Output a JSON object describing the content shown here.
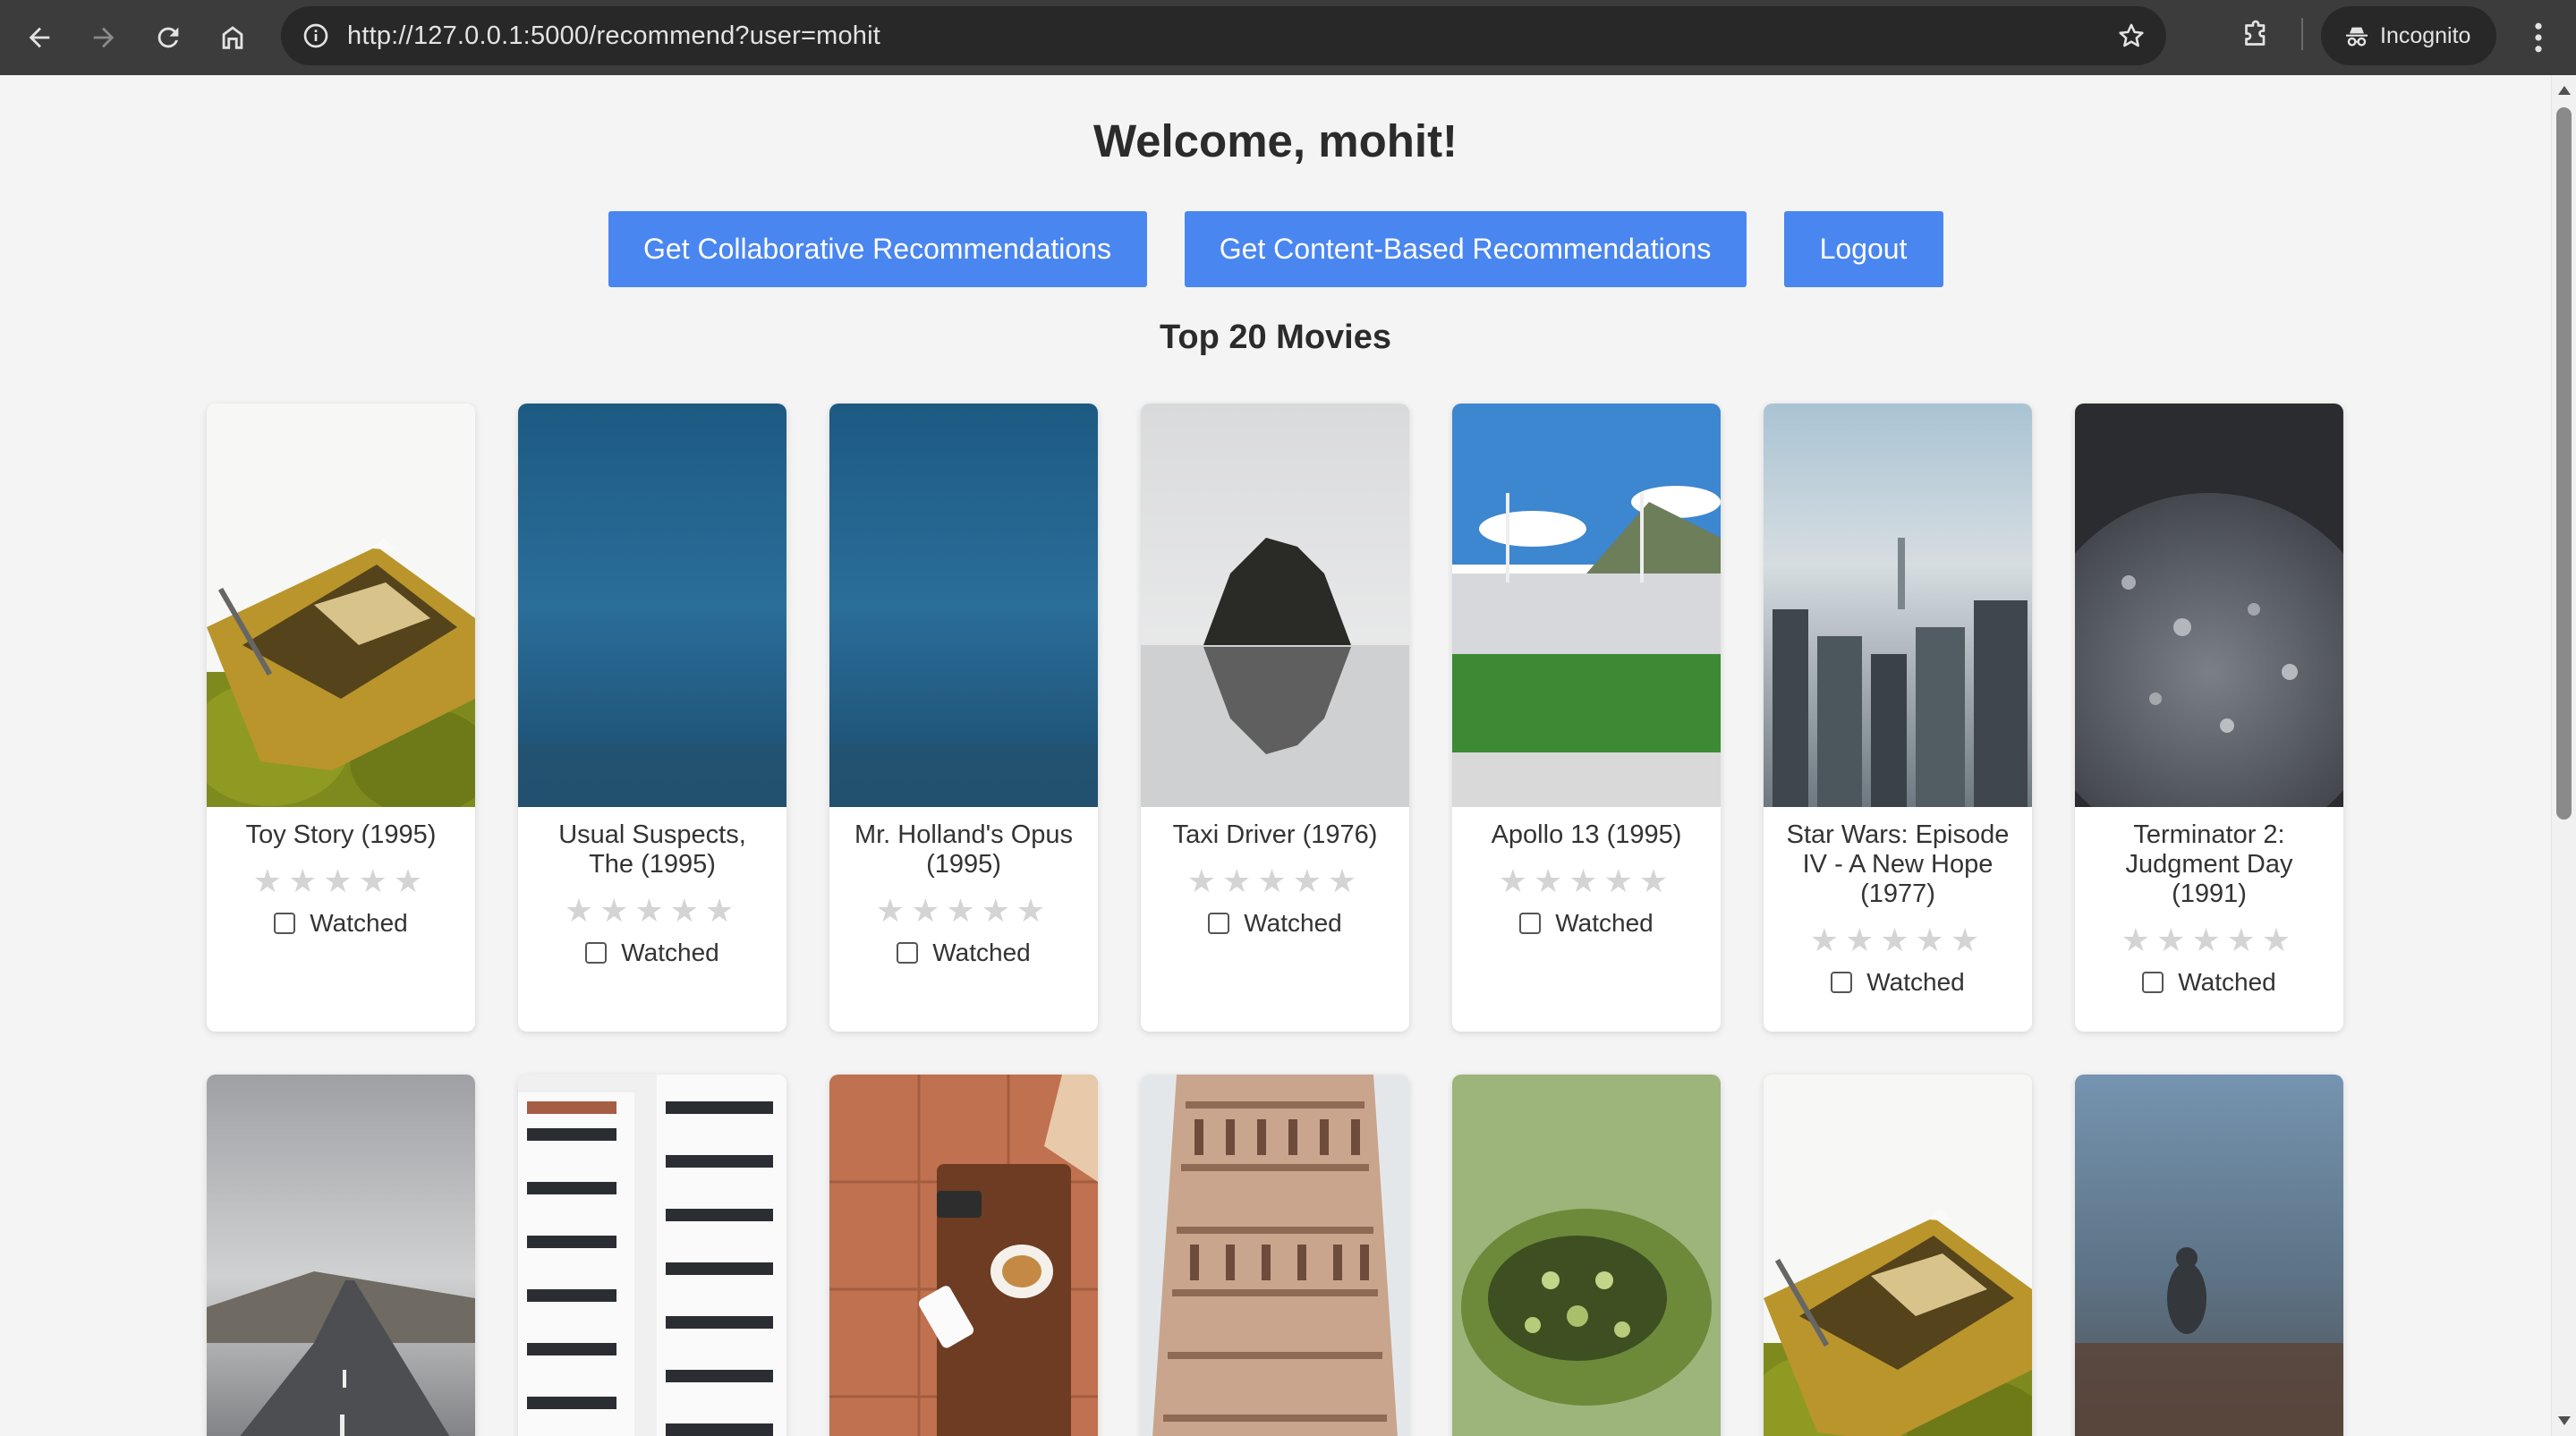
{
  "browser": {
    "url": "http://127.0.0.1:5000/recommend?user=mohit",
    "incognito_label": "Incognito",
    "icons": [
      "back-icon",
      "forward-icon",
      "reload-icon",
      "home-icon",
      "info-icon",
      "bookmark-star-icon",
      "extensions-icon",
      "incognito-icon",
      "menu-icon"
    ]
  },
  "page": {
    "welcome": "Welcome, mohit!",
    "buttons": {
      "collaborative": "Get Collaborative Recommendations",
      "content_based": "Get Content-Based Recommendations",
      "logout": "Logout"
    },
    "section_title": "Top 20 Movies",
    "accent_color": "#4a86f0"
  },
  "movies": [
    {
      "title": "Toy Story (1995)",
      "rating": 0,
      "watched_label": "Watched",
      "watched": false
    },
    {
      "title": "Usual Suspects, The (1995)",
      "rating": 0,
      "watched_label": "Watched",
      "watched": false
    },
    {
      "title": "Mr. Holland's Opus (1995)",
      "rating": 0,
      "watched_label": "Watched",
      "watched": false
    },
    {
      "title": "Taxi Driver (1976)",
      "rating": 0,
      "watched_label": "Watched",
      "watched": false
    },
    {
      "title": "Apollo 13 (1995)",
      "rating": 0,
      "watched_label": "Watched",
      "watched": false
    },
    {
      "title": "Star Wars: Episode IV - A New Hope (1977)",
      "rating": 0,
      "watched_label": "Watched",
      "watched": false
    },
    {
      "title": "Terminator 2: Judgment Day (1991)",
      "rating": 0,
      "watched_label": "Watched",
      "watched": false
    }
  ],
  "star_glyph": "★★★★★"
}
